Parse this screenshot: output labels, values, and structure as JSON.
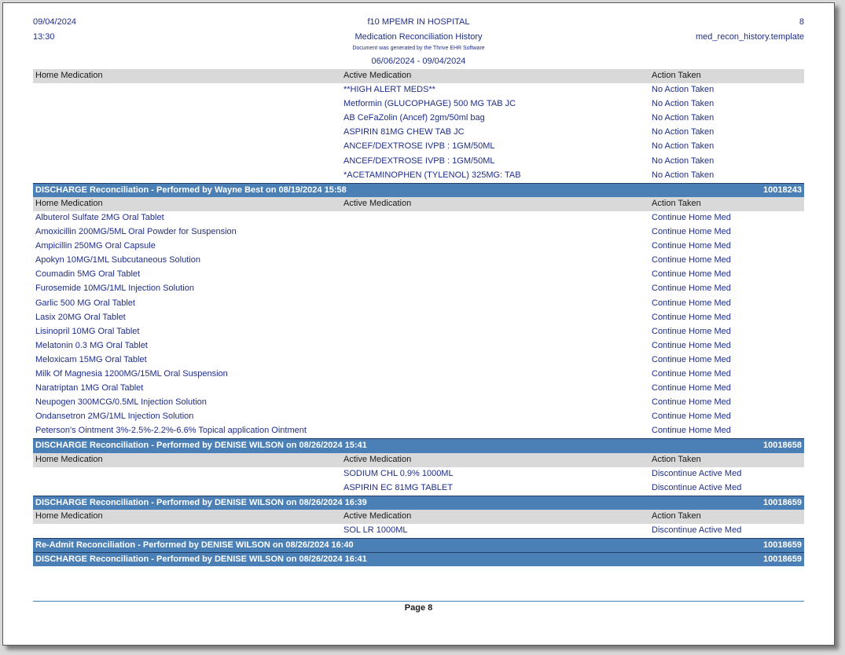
{
  "header": {
    "date": "09/04/2024",
    "time": "13:30",
    "facility": "f10 MPEMR IN HOSPITAL",
    "title": "Medication Reconciliation History",
    "generated_note": "Document was generated by the Thrive EHR Software",
    "date_range": "06/06/2024 - 09/04/2024",
    "page_number": "8",
    "template_name": "med_recon_history.template"
  },
  "columns": {
    "home": "Home Medication",
    "active": "Active Medication",
    "action": "Action Taken"
  },
  "sections": [
    {
      "title": "",
      "id": "",
      "show_columns": true,
      "rows": [
        {
          "home": "",
          "active": "**HIGH ALERT MEDS**",
          "action": "No Action Taken"
        },
        {
          "home": "",
          "active": "Metformin (GLUCOPHAGE) 500 MG TAB JC",
          "action": "No Action Taken"
        },
        {
          "home": "",
          "active": "AB CeFaZolin (Ancef) 2gm/50ml bag",
          "action": "No Action Taken"
        },
        {
          "home": "",
          "active": "ASPIRIN 81MG CHEW TAB JC",
          "action": "No Action Taken"
        },
        {
          "home": "",
          "active": "ANCEF/DEXTROSE IVPB : 1GM/50ML",
          "action": "No Action Taken"
        },
        {
          "home": "",
          "active": "ANCEF/DEXTROSE IVPB : 1GM/50ML",
          "action": "No Action Taken"
        },
        {
          "home": "",
          "active": "*ACETAMINOPHEN (TYLENOL) 325MG: TAB",
          "action": "No Action Taken"
        }
      ]
    },
    {
      "title": "DISCHARGE Reconciliation - Performed by Wayne Best on 08/19/2024 15:58",
      "id": "10018243",
      "show_columns": true,
      "rows": [
        {
          "home": "Albuterol Sulfate 2MG Oral Tablet",
          "active": "",
          "action": "Continue Home Med"
        },
        {
          "home": "Amoxicillin 200MG/5ML Oral Powder for Suspension",
          "active": "",
          "action": "Continue Home Med"
        },
        {
          "home": "Ampicillin 250MG Oral Capsule",
          "active": "",
          "action": "Continue Home Med"
        },
        {
          "home": "Apokyn 10MG/1ML Subcutaneous Solution",
          "active": "",
          "action": "Continue Home Med"
        },
        {
          "home": "Coumadin 5MG Oral Tablet",
          "active": "",
          "action": "Continue Home Med"
        },
        {
          "home": "Furosemide 10MG/1ML Injection Solution",
          "active": "",
          "action": "Continue Home Med"
        },
        {
          "home": "Garlic 500 MG Oral Tablet",
          "active": "",
          "action": "Continue Home Med"
        },
        {
          "home": "Lasix 20MG Oral Tablet",
          "active": "",
          "action": "Continue Home Med"
        },
        {
          "home": "Lisinopril 10MG Oral Tablet",
          "active": "",
          "action": "Continue Home Med"
        },
        {
          "home": "Melatonin 0.3 MG Oral Tablet",
          "active": "",
          "action": "Continue Home Med"
        },
        {
          "home": "Meloxicam 15MG Oral Tablet",
          "active": "",
          "action": "Continue Home Med"
        },
        {
          "home": "Milk Of Magnesia 1200MG/15ML Oral Suspension",
          "active": "",
          "action": "Continue Home Med"
        },
        {
          "home": "Naratriptan 1MG Oral Tablet",
          "active": "",
          "action": "Continue Home Med"
        },
        {
          "home": "Neupogen 300MCG/0.5ML Injection Solution",
          "active": "",
          "action": "Continue Home Med"
        },
        {
          "home": "Ondansetron 2MG/1ML Injection Solution",
          "active": "",
          "action": "Continue Home Med"
        },
        {
          "home": "Peterson's Ointment 3%-2.5%-2.2%-6.6% Topical application Ointment",
          "active": "",
          "action": "Continue Home Med"
        }
      ]
    },
    {
      "title": "DISCHARGE Reconciliation - Performed by DENISE WILSON on 08/26/2024 15:41",
      "id": "10018658",
      "show_columns": true,
      "rows": [
        {
          "home": "",
          "active": "SODIUM CHL 0.9% 1000ML",
          "action": "Discontinue Active Med"
        },
        {
          "home": "",
          "active": "ASPIRIN EC 81MG TABLET",
          "action": "Discontinue Active Med"
        }
      ]
    },
    {
      "title": "DISCHARGE Reconciliation - Performed by DENISE WILSON on 08/26/2024 16:39",
      "id": "10018659",
      "show_columns": true,
      "rows": [
        {
          "home": "",
          "active": "SOL LR 1000ML",
          "action": "Discontinue Active Med"
        }
      ]
    },
    {
      "title": "Re-Admit Reconciliation - Performed by DENISE WILSON on 08/26/2024 16:40",
      "id": "10018659",
      "show_columns": false,
      "rows": []
    },
    {
      "title": "DISCHARGE Reconciliation - Performed by DENISE WILSON on 08/26/2024 16:41",
      "id": "10018659",
      "show_columns": false,
      "rows": []
    }
  ],
  "footer": {
    "page_label": "Page 8"
  }
}
